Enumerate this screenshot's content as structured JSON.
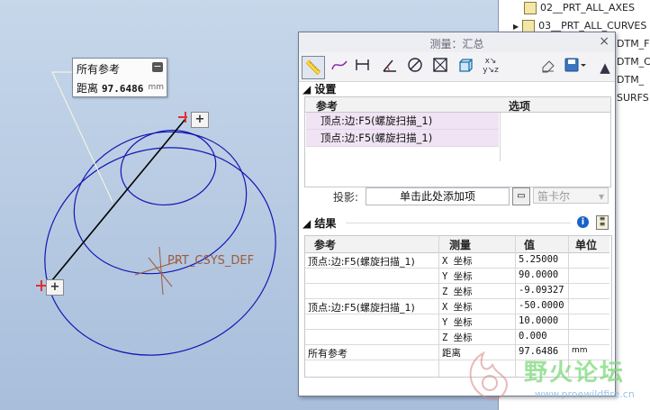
{
  "model_tree": {
    "items": [
      {
        "label": "02__PRT_ALL_AXES"
      },
      {
        "label": "03__PRT_ALL_CURVES"
      },
      {
        "label": "DTM_F"
      },
      {
        "label": "DTM_C"
      },
      {
        "label": "DTM_"
      },
      {
        "label": "SURFS"
      }
    ]
  },
  "callout": {
    "title": "所有参考",
    "distance_label": "距离",
    "distance_value": "97.6486",
    "unit": "mm"
  },
  "viewport": {
    "csys_label": "PRT_CSYS_DEF",
    "handle_symbol": "+",
    "colors": {
      "curve": "#1414b4",
      "line": "#000000",
      "leader": "#f2f2e0",
      "marker": "#e03030"
    }
  },
  "dialog": {
    "title": "测量：汇总",
    "close": "×",
    "toolbar": [
      {
        "icon": "ruler-icon"
      },
      {
        "icon": "length-icon"
      },
      {
        "icon": "distance-icon"
      },
      {
        "icon": "angle-icon"
      },
      {
        "icon": "diameter-icon"
      },
      {
        "icon": "area-icon"
      },
      {
        "icon": "volume-icon"
      },
      {
        "icon": "transform-icon"
      },
      {
        "icon": "eraser-icon"
      },
      {
        "icon": "save-icon"
      }
    ],
    "settings": {
      "header": "设置",
      "col_ref": "参考",
      "col_option": "选项",
      "rows": [
        {
          "ref": "顶点:边:F5(螺旋扫描_1)"
        },
        {
          "ref": "顶点:边:F5(螺旋扫描_1)"
        }
      ]
    },
    "projection": {
      "label": "投影:",
      "input_text": "单击此处添加项",
      "select_value": "笛卡尔"
    },
    "results": {
      "header": "结果",
      "columns": [
        "参考",
        "测量",
        "值",
        "单位"
      ],
      "rows": [
        {
          "ref": "顶点:边:F5(螺旋扫描_1)",
          "measure": "X 坐标",
          "value": "5.25000",
          "unit": ""
        },
        {
          "ref": "",
          "measure": "Y 坐标",
          "value": "90.0000",
          "unit": ""
        },
        {
          "ref": "",
          "measure": "Z 坐标",
          "value": "-9.09327",
          "unit": ""
        },
        {
          "ref": "顶点:边:F5(螺旋扫描_1)",
          "measure": "X 坐标",
          "value": "-50.0000",
          "unit": ""
        },
        {
          "ref": "",
          "measure": "Y 坐标",
          "value": "10.0000",
          "unit": ""
        },
        {
          "ref": "",
          "measure": "Z 坐标",
          "value": "0.000",
          "unit": ""
        },
        {
          "ref": "所有参考",
          "measure": "距离",
          "value": "97.6486",
          "unit": "mm"
        }
      ]
    }
  },
  "watermark": {
    "text": "野火论坛",
    "url": "www.proewildfire.cn"
  }
}
